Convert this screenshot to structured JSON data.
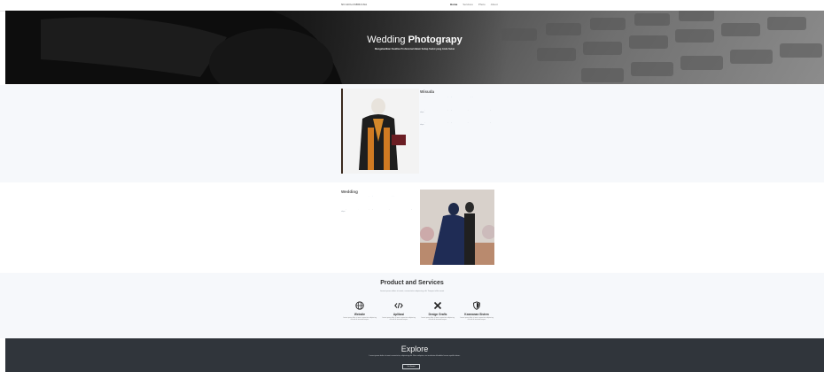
{
  "navbar": {
    "brand": "NICHOLASBRIANA",
    "links": [
      {
        "label": "Home",
        "active": true
      },
      {
        "label": "Services",
        "active": false
      },
      {
        "label": "Photo",
        "active": false
      },
      {
        "label": "About",
        "active": false
      }
    ]
  },
  "hero": {
    "title_light": "Wedding ",
    "title_bold": "Photograpy",
    "subtitle": "Mengabadikan Kualitas Profesional dalam Setiap Sudut yang Anda Sukai"
  },
  "section1": {
    "title": "Wisuda",
    "lead": "Lorem ipsum dolor sit amet, consectetur adipiscing elit. Ullamco laboris nisi ut aliquip ex ea commodo.",
    "body": "Lorem ipsum dolor sit amet, consectetur adipiscing elit. Sed do eiusmod tempor incididunt ut labore et dolore magna aliqua."
  },
  "section2": {
    "title": "Wedding",
    "lead": "Lorem ipsum dolor sit amet, consectetur adipiscing elit. Ullamco laboris nisi ut aliquip ex ea commodo.",
    "body": "Lorem ipsum dolor sit amet, consectetur adipiscing elit. Sed do eiusmod tempor incididunt ut labore et dolore magna aliqua."
  },
  "products": {
    "title": "Product and Services",
    "subtitle": "Lorem ipsum dolor sit amet, consectetur adipiscing elit. Tempor tellus amet",
    "items": [
      {
        "icon": "globe-icon",
        "name": "Website",
        "desc": "Lorem ipsum dolor sit amet consectetur adipiscing elit sed do eiusmod tempor."
      },
      {
        "icon": "code-icon",
        "name": "Aplikasi",
        "desc": "Lorem ipsum dolor sit amet consectetur adipiscing elit sed do eiusmod tempor."
      },
      {
        "icon": "design-tools-icon",
        "name": "Design Grafis",
        "desc": "Lorem ipsum dolor sit amet consectetur adipiscing elit sed do eiusmod tempor."
      },
      {
        "icon": "shield-icon",
        "name": "Keamanan Sistem",
        "desc": "Lorem ipsum dolor sit amet consectetur adipiscing elit sed do eiusmod tempor."
      }
    ]
  },
  "explore": {
    "title": "Explore",
    "text": "Lorem ipsum dolor sit amet consectetur, adipisicing elit. Illum voluptas, nisi molestiae blanditiis harum repellat totam.",
    "button": "Get Started"
  },
  "colors": {
    "hero_dark": "#1a1a1a",
    "section_alt": "#f6f8fb",
    "explore_bg": "#30353b"
  }
}
